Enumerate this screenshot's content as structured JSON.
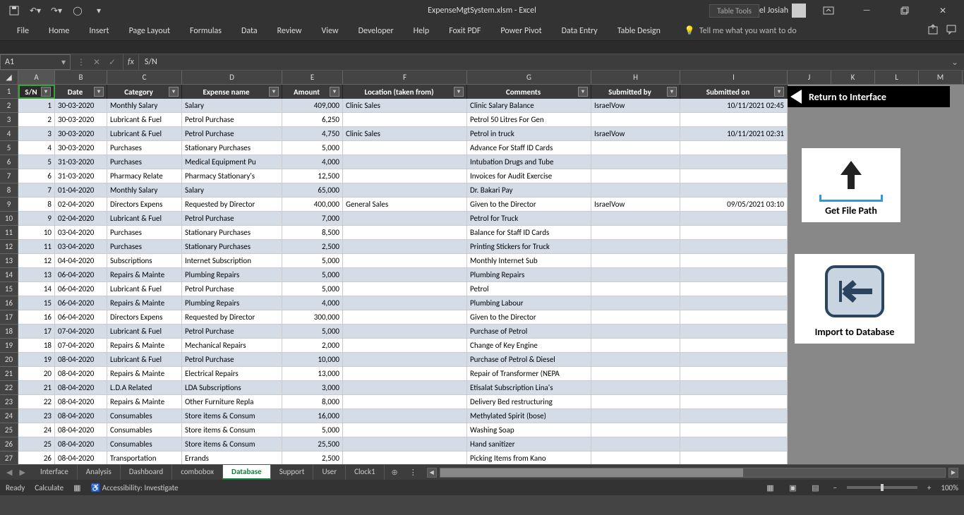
{
  "titlebar": {
    "filename": "ExpenseMgtSystem.xlsm  -  Excel",
    "tabletools": "Table Tools",
    "username": "Israel Josiah"
  },
  "ribbon": {
    "tabs": [
      "File",
      "Home",
      "Insert",
      "Page Layout",
      "Formulas",
      "Data",
      "Review",
      "View",
      "Developer",
      "Help",
      "Foxit PDF",
      "Power Pivot",
      "Data Entry",
      "Table Design"
    ],
    "tellme": "Tell me what you want to do"
  },
  "namebox": "A1",
  "formula": "S/N",
  "columns": [
    "A",
    "B",
    "C",
    "D",
    "E",
    "F",
    "G",
    "H",
    "I"
  ],
  "extra_columns": [
    "J",
    "K",
    "L",
    "M"
  ],
  "table_headers": {
    "A": "S/N",
    "B": "Date",
    "C": "Category",
    "D": "Expense name",
    "E": "Amount",
    "F": "Location (taken from)",
    "G": "Comments",
    "H": "Submitted by",
    "I": "Submitted on"
  },
  "rows": [
    {
      "sn": "1",
      "date": "30-03-2020",
      "cat": "Monthly Salary",
      "exp": "Salary",
      "amt": "409,000",
      "loc": "Clinic Sales",
      "com": "Clinic Salary Balance",
      "by": "IsraelVow",
      "on": "10/11/2021 02:45"
    },
    {
      "sn": "2",
      "date": "30-03-2020",
      "cat": "Lubricant & Fuel",
      "exp": "Petrol Purchase",
      "amt": "6,250",
      "loc": "",
      "com": "Petrol 50 Litres For Gen",
      "by": "",
      "on": ""
    },
    {
      "sn": "3",
      "date": "30-03-2020",
      "cat": "Lubricant & Fuel",
      "exp": "Petrol Purchase",
      "amt": "4,750",
      "loc": "Clinic Sales",
      "com": "Petrol in truck",
      "by": "IsraelVow",
      "on": "10/11/2021 02:31"
    },
    {
      "sn": "4",
      "date": "30-03-2020",
      "cat": "Purchases",
      "exp": "Stationary Purchases",
      "amt": "5,000",
      "loc": "",
      "com": "Advance For Staff ID Cards",
      "by": "",
      "on": ""
    },
    {
      "sn": "5",
      "date": "31-03-2020",
      "cat": "Purchases",
      "exp": "Medical Equipment Pu",
      "amt": "4,000",
      "loc": "",
      "com": "Intubation Drugs and Tube",
      "by": "",
      "on": ""
    },
    {
      "sn": "6",
      "date": "31-03-2020",
      "cat": "Pharmacy Relate",
      "exp": "Pharmacy Stationary's",
      "amt": "12,500",
      "loc": "",
      "com": "Invoices for Audit Exercise",
      "by": "",
      "on": ""
    },
    {
      "sn": "7",
      "date": "01-04-2020",
      "cat": "Monthly Salary",
      "exp": "Salary",
      "amt": "65,000",
      "loc": "",
      "com": "Dr. Bakari Pay",
      "by": "",
      "on": ""
    },
    {
      "sn": "8",
      "date": "02-04-2020",
      "cat": "Directors Expens",
      "exp": "Requested by Director",
      "amt": "400,000",
      "loc": "General Sales",
      "com": "Given to the Director",
      "by": "IsraelVow",
      "on": "09/05/2021 03:10"
    },
    {
      "sn": "9",
      "date": "02-04-2020",
      "cat": "Lubricant & Fuel",
      "exp": "Petrol Purchase",
      "amt": "7,000",
      "loc": "",
      "com": "Petrol for Truck",
      "by": "",
      "on": ""
    },
    {
      "sn": "10",
      "date": "03-04-2020",
      "cat": "Purchases",
      "exp": "Stationary Purchases",
      "amt": "8,500",
      "loc": "",
      "com": "Balance for Staff ID Cards",
      "by": "",
      "on": ""
    },
    {
      "sn": "11",
      "date": "03-04-2020",
      "cat": "Purchases",
      "exp": "Stationary Purchases",
      "amt": "2,500",
      "loc": "",
      "com": "Printing Stickers for Truck",
      "by": "",
      "on": ""
    },
    {
      "sn": "12",
      "date": "04-04-2020",
      "cat": "Subscriptions",
      "exp": "Internet Subscription",
      "amt": "5,000",
      "loc": "",
      "com": "Monthly Internet Sub",
      "by": "",
      "on": ""
    },
    {
      "sn": "13",
      "date": "06-04-2020",
      "cat": "Repairs & Mainte",
      "exp": "Plumbing Repairs",
      "amt": "5,000",
      "loc": "",
      "com": "Plumbing Repairs",
      "by": "",
      "on": ""
    },
    {
      "sn": "14",
      "date": "06-04-2020",
      "cat": "Lubricant & Fuel",
      "exp": "Petrol Purchase",
      "amt": "5,000",
      "loc": "",
      "com": "Petrol",
      "by": "",
      "on": ""
    },
    {
      "sn": "15",
      "date": "06-04-2020",
      "cat": "Repairs & Mainte",
      "exp": "Plumbing Repairs",
      "amt": "4,000",
      "loc": "",
      "com": "Plumbing Labour",
      "by": "",
      "on": ""
    },
    {
      "sn": "16",
      "date": "06-04-2020",
      "cat": "Directors Expens",
      "exp": "Requested by Director",
      "amt": "300,000",
      "loc": "",
      "com": "Given to the Director",
      "by": "",
      "on": ""
    },
    {
      "sn": "17",
      "date": "07-04-2020",
      "cat": "Lubricant & Fuel",
      "exp": "Petrol Purchase",
      "amt": "5,000",
      "loc": "",
      "com": "Purchase of Petrol",
      "by": "",
      "on": ""
    },
    {
      "sn": "18",
      "date": "07-04-2020",
      "cat": "Repairs & Mainte",
      "exp": "Mechanical Repairs",
      "amt": "2,000",
      "loc": "",
      "com": "Change of Key Engine",
      "by": "",
      "on": ""
    },
    {
      "sn": "19",
      "date": "08-04-2020",
      "cat": "Lubricant & Fuel",
      "exp": "Petrol Purchase",
      "amt": "10,000",
      "loc": "",
      "com": "Purchase of Petrol & Diesel",
      "by": "",
      "on": ""
    },
    {
      "sn": "20",
      "date": "08-04-2020",
      "cat": "Repairs & Mainte",
      "exp": "Electrical Repairs",
      "amt": "13,000",
      "loc": "",
      "com": "Repair of Transformer (NEPA",
      "by": "",
      "on": ""
    },
    {
      "sn": "21",
      "date": "08-04-2020",
      "cat": "L.D.A Related",
      "exp": "LDA Subscriptions",
      "amt": "3,000",
      "loc": "",
      "com": "Etisalat Subscription Lina's",
      "by": "",
      "on": ""
    },
    {
      "sn": "22",
      "date": "08-04-2020",
      "cat": "Repairs & Mainte",
      "exp": "Other Furniture Repla",
      "amt": "8,000",
      "loc": "",
      "com": "Delivery Bed restructuring",
      "by": "",
      "on": ""
    },
    {
      "sn": "23",
      "date": "08-04-2020",
      "cat": "Consumables",
      "exp": "Store items & Consum",
      "amt": "16,000",
      "loc": "",
      "com": "Methylated Spirit (bose)",
      "by": "",
      "on": ""
    },
    {
      "sn": "24",
      "date": "08-04-2020",
      "cat": "Consumables",
      "exp": "Store items & Consum",
      "amt": "5,000",
      "loc": "",
      "com": "Washing Soap",
      "by": "",
      "on": ""
    },
    {
      "sn": "25",
      "date": "08-04-2020",
      "cat": "Consumables",
      "exp": "Store items & Consum",
      "amt": "25,500",
      "loc": "",
      "com": "Hand sanitizer",
      "by": "",
      "on": ""
    },
    {
      "sn": "26",
      "date": "08-04-2020",
      "cat": "Transportation",
      "exp": "Errands",
      "amt": "2,500",
      "loc": "",
      "com": "Picking Items from Kano",
      "by": "",
      "on": ""
    }
  ],
  "floating": {
    "return": "Return to Interface",
    "getfile": "Get File Path",
    "import": "Import to Database"
  },
  "sheet_tabs": [
    "Interface",
    "Analysis",
    "Dashboard",
    "combobox",
    "Database",
    "Support",
    "User",
    "Clock1"
  ],
  "active_sheet": "Database",
  "statusbar": {
    "ready": "Ready",
    "calc": "Calculate",
    "access": "Accessibility: Investigate",
    "zoom": "100%"
  }
}
